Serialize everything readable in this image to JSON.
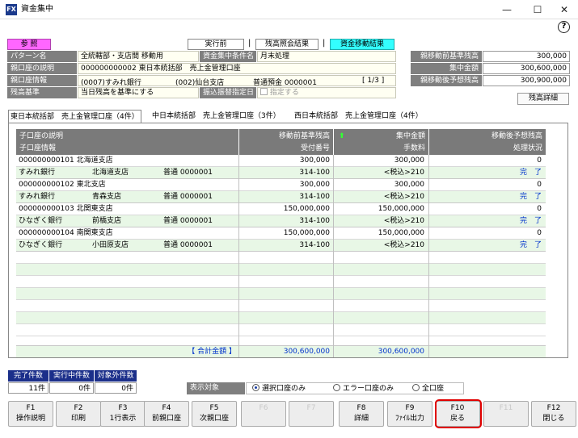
{
  "window": {
    "title": "資金集中",
    "icon": "app-icon",
    "minimize": "—",
    "maximize": "☐",
    "close": "✕",
    "help": "?"
  },
  "header": {
    "mode_label": "参 照",
    "btn_before": "実行前",
    "btn_inquiry": "残高照会結果",
    "btn_moved": "資金移動結果",
    "pattern_label": "パターン名",
    "pattern_value": "全統轄部・支店間 移動用",
    "cond_label": "資金集中条件名",
    "cond_value": "月末処理",
    "parent_desc_label": "親口座の説明",
    "parent_desc_value": "000000000002 東日本統括部　売上金管理口座",
    "parent_info_label": "親口座情報",
    "parent_bank": "(0007)すみれ銀行",
    "parent_branch": "(002)仙台支店",
    "parent_account": "普通預金 0000001",
    "parent_page": "[ 1/3 ]",
    "balance_basis_label": "残高基準",
    "balance_basis_value": "当日残高を基準にする",
    "transfer_label": "振込振替指定日",
    "transfer_checkbox": "指定する",
    "pre_balance_label": "親移動前基準残高",
    "pre_balance_value": "300,000",
    "collected_label": "集中金額",
    "collected_value": "300,600,000",
    "post_balance_label": "親移動後予想残高",
    "post_balance_value": "300,900,000",
    "detail_button": "残高詳細"
  },
  "tabs": [
    "東日本統括部　売上金管理口座（4件）",
    "中日本統括部　売上金管理口座（3件）",
    "西日本統括部　売上金管理口座（4件）"
  ],
  "grid": {
    "headers": {
      "col1_top": "子口座の説明",
      "col1_bottom": "子口座情報",
      "col2_top": "移動前基準残高",
      "col2_bottom": "受付番号",
      "col3_top": "集中金額",
      "col3_bottom": "手数料",
      "col4_top": "移動後予想残高",
      "col4_bottom": "処理状況"
    },
    "accounts": [
      {
        "desc": "000000000101 北海道支店",
        "pre": "300,000",
        "amount": "300,000",
        "post": "0",
        "bank": "すみれ銀行",
        "branch": "北海道支店",
        "acct": "普通 0000001",
        "receipt": "314-100",
        "fee": "<税込>210",
        "status": "完　了"
      },
      {
        "desc": "000000000102 東北支店",
        "pre": "300,000",
        "amount": "300,000",
        "post": "0",
        "bank": "すみれ銀行",
        "branch": "青森支店",
        "acct": "普通 0000001",
        "receipt": "314-100",
        "fee": "<税込>210",
        "status": "完　了"
      },
      {
        "desc": "000000000103 北関東支店",
        "pre": "150,000,000",
        "amount": "150,000,000",
        "post": "0",
        "bank": "ひなぎく銀行",
        "branch": "前橋支店",
        "acct": "普通 0000001",
        "receipt": "314-100",
        "fee": "<税込>210",
        "status": "完　了"
      },
      {
        "desc": "000000000104 南関東支店",
        "pre": "150,000,000",
        "amount": "150,000,000",
        "post": "0",
        "bank": "ひなぎく銀行",
        "branch": "小田原支店",
        "acct": "普通 0000001",
        "receipt": "314-100",
        "fee": "<税込>210",
        "status": "完　了"
      }
    ],
    "total_label": "【 合計金額 】",
    "total_pre": "300,600,000",
    "total_amount": "300,600,000"
  },
  "counts": {
    "done_label": "完了件数",
    "done_value": "11件",
    "running_label": "実行中件数",
    "running_value": "0件",
    "excluded_label": "対象外件数",
    "excluded_value": "0件"
  },
  "display": {
    "label": "表示対象",
    "opt1": "選択口座のみ",
    "opt2": "エラー口座のみ",
    "opt3": "全口座"
  },
  "fkeys": [
    {
      "key": "F1",
      "label": "操作説明"
    },
    {
      "key": "F2",
      "label": "印刷"
    },
    {
      "key": "F3",
      "label": "1行表示"
    },
    {
      "key": "F4",
      "label": "前親口座"
    },
    {
      "key": "F5",
      "label": "次親口座"
    },
    {
      "key": "F6",
      "label": ""
    },
    {
      "key": "F7",
      "label": ""
    },
    {
      "key": "F8",
      "label": "詳細"
    },
    {
      "key": "F9",
      "label": "ﾌｧｲﾙ出力"
    },
    {
      "key": "F10",
      "label": "戻る"
    },
    {
      "key": "F11",
      "label": ""
    },
    {
      "key": "F12",
      "label": "閉じる"
    }
  ],
  "colors": {
    "mode": "#ff66ff",
    "moved": "#33ffff",
    "highlight": "#e00000",
    "done_badge": "#1b2f8a"
  }
}
